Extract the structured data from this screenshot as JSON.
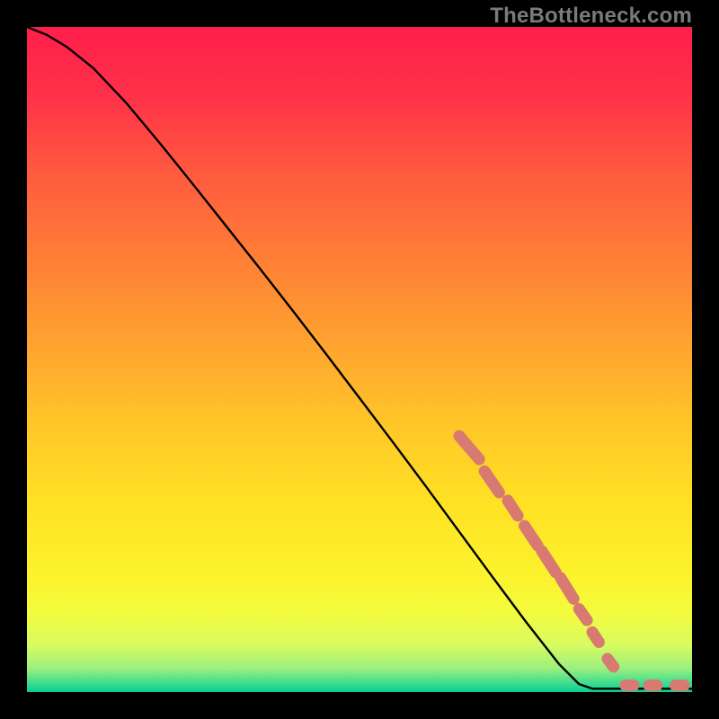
{
  "watermark": "TheBottleneck.com",
  "chart_data": {
    "type": "line",
    "title": "",
    "xlabel": "",
    "ylabel": "",
    "xlim": [
      0,
      100
    ],
    "ylim": [
      0,
      100
    ],
    "curve": [
      {
        "x": 0,
        "y": 100
      },
      {
        "x": 3,
        "y": 98.8
      },
      {
        "x": 6,
        "y": 97.0
      },
      {
        "x": 10,
        "y": 93.8
      },
      {
        "x": 15,
        "y": 88.5
      },
      {
        "x": 20,
        "y": 82.5
      },
      {
        "x": 25,
        "y": 76.3
      },
      {
        "x": 30,
        "y": 70.0
      },
      {
        "x": 35,
        "y": 63.7
      },
      {
        "x": 40,
        "y": 57.3
      },
      {
        "x": 45,
        "y": 50.8
      },
      {
        "x": 50,
        "y": 44.2
      },
      {
        "x": 55,
        "y": 37.6
      },
      {
        "x": 60,
        "y": 30.9
      },
      {
        "x": 65,
        "y": 24.1
      },
      {
        "x": 70,
        "y": 17.3
      },
      {
        "x": 75,
        "y": 10.6
      },
      {
        "x": 80,
        "y": 4.2
      },
      {
        "x": 83,
        "y": 1.2
      },
      {
        "x": 85,
        "y": 0.5
      },
      {
        "x": 90,
        "y": 0.5
      },
      {
        "x": 95,
        "y": 0.5
      },
      {
        "x": 100,
        "y": 0.5
      }
    ],
    "dash_groups": [
      [
        {
          "x": 65.0,
          "y": 38.5
        },
        {
          "x": 68.0,
          "y": 35.0
        }
      ],
      [
        {
          "x": 68.8,
          "y": 33.2
        },
        {
          "x": 71.0,
          "y": 30.0
        }
      ],
      [
        {
          "x": 72.3,
          "y": 28.8
        },
        {
          "x": 73.8,
          "y": 26.5
        }
      ],
      [
        {
          "x": 74.8,
          "y": 25.0
        },
        {
          "x": 76.8,
          "y": 22.0
        }
      ],
      [
        {
          "x": 77.4,
          "y": 21.2
        },
        {
          "x": 79.5,
          "y": 18.0
        }
      ],
      [
        {
          "x": 80.2,
          "y": 17.2
        },
        {
          "x": 82.2,
          "y": 14.0
        }
      ],
      [
        {
          "x": 83.0,
          "y": 12.5
        },
        {
          "x": 84.2,
          "y": 10.8
        }
      ],
      [
        {
          "x": 85.0,
          "y": 9.0
        },
        {
          "x": 86.0,
          "y": 7.5
        }
      ],
      [
        {
          "x": 87.3,
          "y": 5.0
        },
        {
          "x": 88.2,
          "y": 3.8
        }
      ],
      [
        {
          "x": 90.0,
          "y": 1.0
        },
        {
          "x": 91.2,
          "y": 1.0
        }
      ],
      [
        {
          "x": 93.5,
          "y": 1.0
        },
        {
          "x": 94.7,
          "y": 1.0
        }
      ],
      [
        {
          "x": 97.5,
          "y": 1.0
        },
        {
          "x": 98.8,
          "y": 1.0
        }
      ]
    ],
    "gradient_stops": [
      {
        "offset": 0.0,
        "color": "#ff1e4b"
      },
      {
        "offset": 0.1,
        "color": "#ff3049"
      },
      {
        "offset": 0.22,
        "color": "#ff5a3f"
      },
      {
        "offset": 0.35,
        "color": "#ff7f36"
      },
      {
        "offset": 0.48,
        "color": "#ffa42f"
      },
      {
        "offset": 0.6,
        "color": "#ffc728"
      },
      {
        "offset": 0.72,
        "color": "#ffe224"
      },
      {
        "offset": 0.82,
        "color": "#fcf22b"
      },
      {
        "offset": 0.88,
        "color": "#f4fb3e"
      },
      {
        "offset": 0.93,
        "color": "#d6fb60"
      },
      {
        "offset": 0.965,
        "color": "#9af07e"
      },
      {
        "offset": 0.985,
        "color": "#44de8f"
      },
      {
        "offset": 1.0,
        "color": "#09cf8f"
      }
    ],
    "colors": {
      "curve": "#000000",
      "dash": "#d87a72"
    }
  }
}
